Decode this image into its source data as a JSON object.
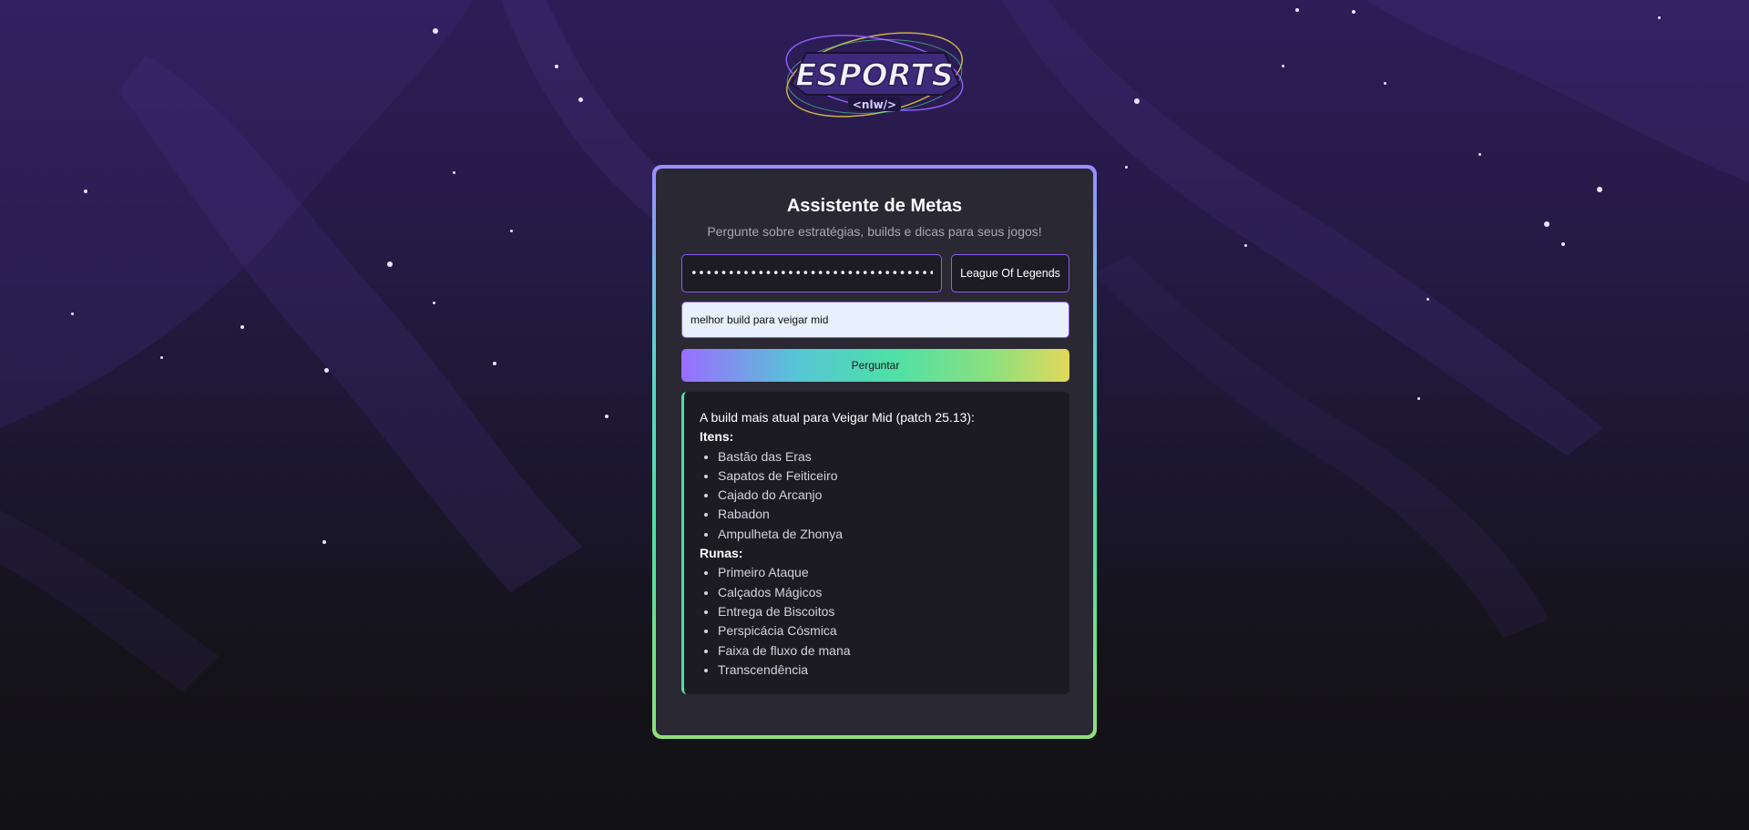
{
  "logo": {
    "main_text": "ESPORTS",
    "tag_text": "<nlw/>"
  },
  "card": {
    "title": "Assistente de Metas",
    "subtitle": "Pergunte sobre estratégias, builds e dicas para seus jogos!",
    "api_key_value": "••••••••••••••••••••••••••••••••••••••",
    "game_select_value": "League Of Legends",
    "question_value": "melhor build para veigar mid",
    "ask_button_label": "Perguntar"
  },
  "answer": {
    "intro": "A build mais atual para Veigar Mid (patch 25.13):",
    "items_label": "Itens:",
    "items": [
      "Bastão das Eras",
      "Sapatos de Feiticeiro",
      "Cajado do Arcanjo",
      "Rabadon",
      "Ampulheta de Zhonya"
    ],
    "runes_label": "Runas:",
    "runes": [
      "Primeiro Ataque",
      "Calçados Mágicos",
      "Entrega de Biscoitos",
      "Perspicácia Cósmica",
      "Faixa de fluxo de mana",
      "Transcendência"
    ]
  },
  "colors": {
    "accent_purple": "#8b5cf6",
    "accent_green": "#4fe0a6",
    "card_bg": "#2a2833",
    "answer_bg": "#1c1b22"
  }
}
